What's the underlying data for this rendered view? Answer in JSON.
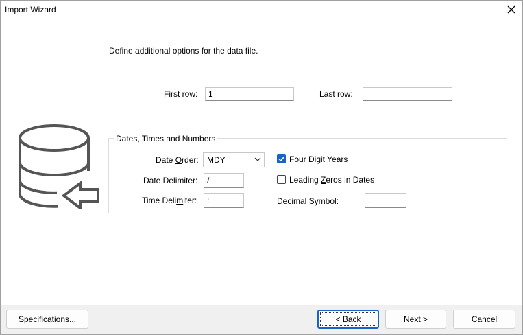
{
  "window": {
    "title": "Import Wizard"
  },
  "description": "Define additional options for the data file.",
  "rows": {
    "first_label": "First row:",
    "first_value": "1",
    "last_label": "Last row:",
    "last_value": ""
  },
  "group": {
    "title": "Dates, Times and Numbers",
    "date_order": {
      "label_pre": "Date ",
      "label_ul": "O",
      "label_post": "rder:",
      "value": "MDY"
    },
    "date_delimiter": {
      "label": "Date Delimiter:",
      "value": "/"
    },
    "time_delimiter": {
      "label_pre": "Time Deli",
      "label_ul": "m",
      "label_post": "iter:",
      "value": ":"
    },
    "four_digit_years": {
      "label_pre": "Four Digit ",
      "label_ul": "Y",
      "label_post": "ears",
      "checked": true
    },
    "leading_zeros": {
      "label_pre": "Leading ",
      "label_ul": "Z",
      "label_post": "eros in Dates",
      "checked": false
    },
    "decimal_symbol": {
      "label": "Decimal Symbol:",
      "value": "."
    }
  },
  "buttons": {
    "specifications": "Specifications...",
    "back": {
      "pre": "< ",
      "ul": "B",
      "post": "ack"
    },
    "next": {
      "pre": "",
      "ul": "N",
      "post": "ext >"
    },
    "cancel": {
      "pre": "",
      "ul": "C",
      "post": "ancel"
    }
  },
  "icons": {
    "database": "database-import-icon",
    "close": "close-icon",
    "dropdown": "chevron-down-icon",
    "check": "checkmark-icon"
  },
  "colors": {
    "accent": "#1a62c6",
    "footer": "#f0f0f0",
    "icon": "#555555"
  }
}
